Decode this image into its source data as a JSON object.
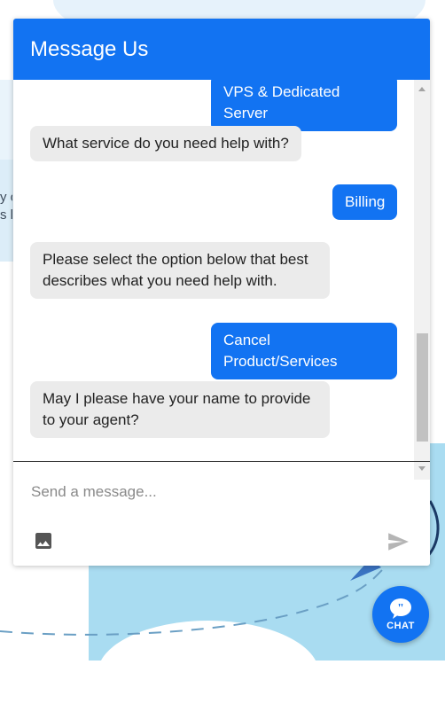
{
  "header": {
    "title": "Message Us"
  },
  "messages": [
    {
      "sender": "user",
      "text": "VPS & Dedicated Server"
    },
    {
      "sender": "bot",
      "text": "What service do you need help with?"
    },
    {
      "sender": "user",
      "text": "Billing"
    },
    {
      "sender": "bot",
      "text": "Please select the option below that best describes what you need help with."
    },
    {
      "sender": "user",
      "text": "Cancel Product/Services"
    },
    {
      "sender": "bot",
      "text": "May I please have your name to provide to your agent?"
    }
  ],
  "composer": {
    "placeholder": "Send a message...",
    "attach_icon": "image-icon",
    "send_icon": "send-icon"
  },
  "chat_button": {
    "label": "CHAT",
    "icon": "chat-bubble-icon"
  },
  "background_peek": {
    "line1": "y o",
    "line2": "s l"
  },
  "colors": {
    "accent": "#1273f2",
    "bot_bubble": "#ebebeb"
  }
}
